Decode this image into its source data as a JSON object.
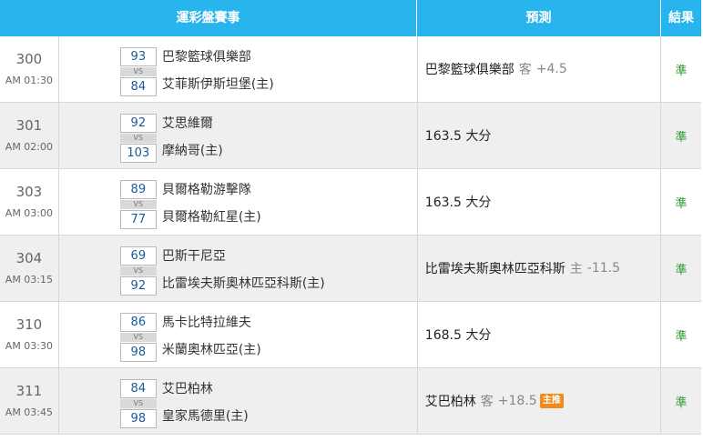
{
  "header": {
    "event": "運彩盤賽事",
    "prediction": "預測",
    "result": "結果"
  },
  "rows": [
    {
      "id": "300",
      "time": "AM 01:30",
      "score1": "93",
      "vs": "VS",
      "score2": "84",
      "team1": "巴黎籃球俱樂部",
      "team2": "艾菲斯伊斯坦堡(主)",
      "pred_main": "巴黎籃球俱樂部",
      "pred_side": "客",
      "pred_line": "+4.5",
      "badge": "",
      "result": "準"
    },
    {
      "id": "301",
      "time": "AM 02:00",
      "score1": "92",
      "vs": "VS",
      "score2": "103",
      "team1": "艾思維爾",
      "team2": "摩納哥(主)",
      "pred_main": "163.5 大分",
      "pred_side": "",
      "pred_line": "",
      "badge": "",
      "result": "準"
    },
    {
      "id": "303",
      "time": "AM 03:00",
      "score1": "89",
      "vs": "VS",
      "score2": "77",
      "team1": "貝爾格勒游擊隊",
      "team2": "貝爾格勒紅星(主)",
      "pred_main": "163.5 大分",
      "pred_side": "",
      "pred_line": "",
      "badge": "",
      "result": "準"
    },
    {
      "id": "304",
      "time": "AM 03:15",
      "score1": "69",
      "vs": "VS",
      "score2": "92",
      "team1": "巴斯干尼亞",
      "team2": "比雷埃夫斯奧林匹亞科斯(主)",
      "pred_main": "比雷埃夫斯奧林匹亞科斯",
      "pred_side": "主",
      "pred_line": "-11.5",
      "badge": "",
      "result": "準"
    },
    {
      "id": "310",
      "time": "AM 03:30",
      "score1": "86",
      "vs": "VS",
      "score2": "98",
      "team1": "馬卡比特拉維夫",
      "team2": "米蘭奧林匹亞(主)",
      "pred_main": "168.5 大分",
      "pred_side": "",
      "pred_line": "",
      "badge": "",
      "result": "準"
    },
    {
      "id": "311",
      "time": "AM 03:45",
      "score1": "84",
      "vs": "VS",
      "score2": "98",
      "team1": "艾巴柏林",
      "team2": "皇家馬德里(主)",
      "pred_main": "艾巴柏林",
      "pred_side": "客",
      "pred_line": "+18.5",
      "badge": "主推",
      "result": "準"
    }
  ],
  "colors": {
    "header_bg": "#28b5ee",
    "result_green": "#2a9a2a",
    "badge_orange": "#f08a1c",
    "score_blue": "#1a5a9a"
  }
}
